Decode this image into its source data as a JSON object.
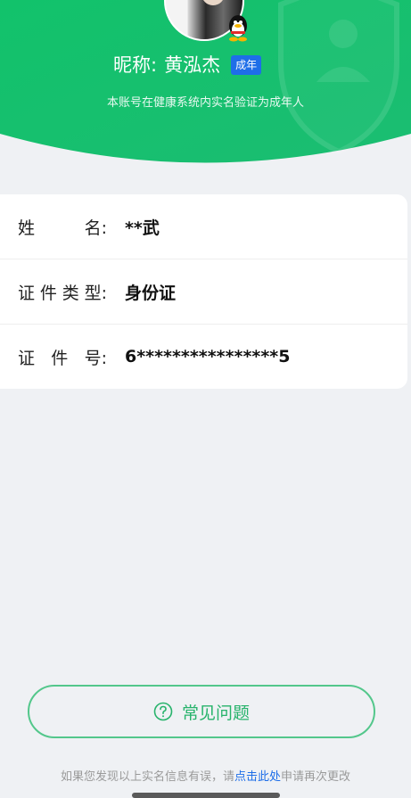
{
  "profile": {
    "nickname_label": "昵称:",
    "nickname": "黄泓杰",
    "badge": "成年",
    "verify_note": "本账号在健康系统内实名验证为成年人"
  },
  "info": {
    "name_label_chars": [
      "姓",
      "名:"
    ],
    "name_value": "**武",
    "id_type_label_chars": [
      "证",
      "件",
      "类",
      "型:"
    ],
    "id_type_value": "身份证",
    "id_number_label_chars": [
      "证",
      "件",
      "号:"
    ],
    "id_number_value": "6****************5"
  },
  "faq": {
    "label": "常见问题",
    "icon": "question-circle-icon"
  },
  "footer": {
    "prefix": "如果您发现以上实名信息有误，请",
    "link": "点击此处",
    "suffix": "申请再次更改"
  },
  "colors": {
    "header_green": "#16c06e",
    "badge_blue": "#1e6ee8",
    "faq_green": "#27b36b",
    "background": "#eff1f4"
  }
}
